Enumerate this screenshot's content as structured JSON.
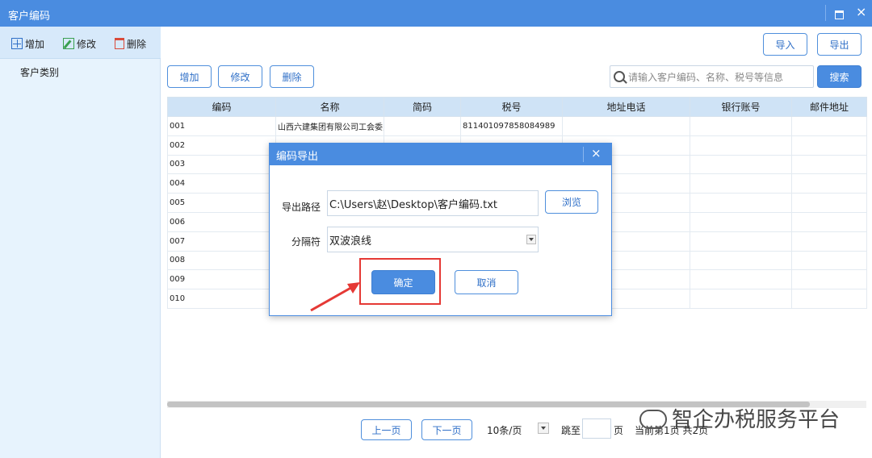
{
  "window": {
    "title": "客户编码"
  },
  "sidebar": {
    "add_label": "增加",
    "edit_label": "修改",
    "delete_label": "删除",
    "category_label": "客户类别"
  },
  "top_actions": {
    "import_label": "导入",
    "export_label": "导出"
  },
  "main_toolbar": {
    "add_label": "增加",
    "edit_label": "修改",
    "delete_label": "删除"
  },
  "search": {
    "placeholder": "请输入客户编码、名称、税号等信息",
    "button_label": "搜索"
  },
  "table": {
    "columns": [
      "编码",
      "名称",
      "简码",
      "税号",
      "地址电话",
      "银行账号",
      "邮件地址"
    ],
    "rows": [
      [
        "001",
        "山西六建集团有限公司工会委员",
        "",
        "811401097858084989",
        "",
        "",
        ""
      ],
      [
        "002",
        "",
        "",
        "",
        "",
        "",
        ""
      ],
      [
        "003",
        "",
        "",
        "",
        "",
        "",
        ""
      ],
      [
        "004",
        "",
        "",
        "",
        "",
        "",
        ""
      ],
      [
        "005",
        "",
        "",
        "",
        "",
        "",
        ""
      ],
      [
        "006",
        "",
        "",
        "",
        "",
        "",
        ""
      ],
      [
        "007",
        "",
        "",
        "",
        "",
        "",
        ""
      ],
      [
        "008",
        "",
        "",
        "",
        "",
        "",
        ""
      ],
      [
        "009",
        "",
        "",
        "",
        "",
        "",
        ""
      ],
      [
        "010",
        "",
        "",
        "",
        "",
        "",
        ""
      ]
    ]
  },
  "pager": {
    "prev_label": "上一页",
    "next_label": "下一页",
    "page_size": "10条/页",
    "goto_label": "跳至",
    "page_unit": "页",
    "status": "当前第1页 共2页"
  },
  "watermark": {
    "text": "智企办税服务平台"
  },
  "dialog": {
    "title": "编码导出",
    "path_label": "导出路径",
    "path_value": "C:\\Users\\赵\\Desktop\\客户编码.txt",
    "browse_label": "浏览",
    "separator_label": "分隔符",
    "separator_value": "双波浪线",
    "ok_label": "确定",
    "cancel_label": "取消"
  },
  "colors": {
    "accent": "#4a8ce0",
    "highlight": "#e53935"
  }
}
